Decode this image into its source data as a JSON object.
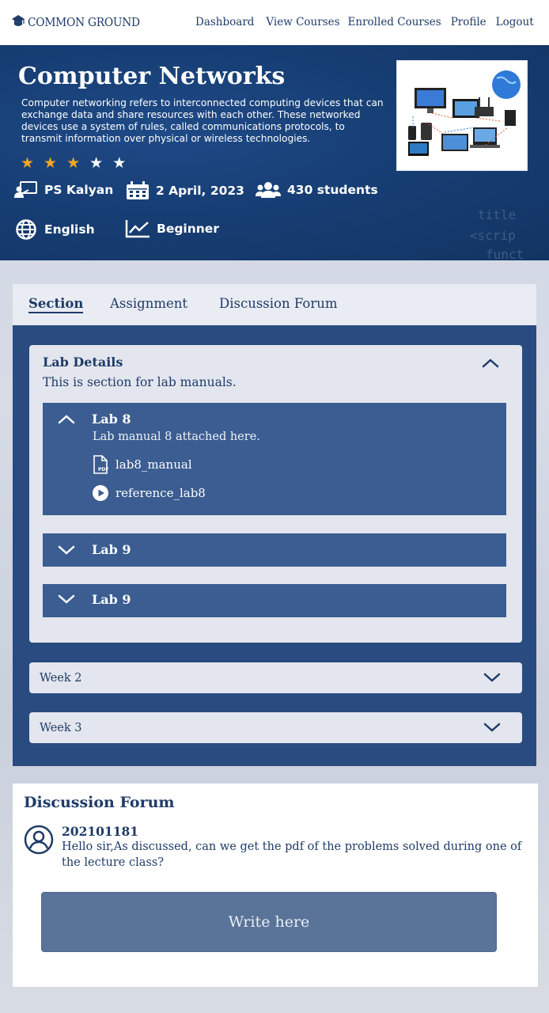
{
  "nav": {
    "brand": "COMMON GROUND",
    "links": [
      "Dashboard",
      "View Courses",
      "Enrolled Courses",
      "Profile",
      "Logout"
    ]
  },
  "course": {
    "title": "Computer Networks",
    "description": "Computer networking refers to interconnected computing devices that can exchange data and share resources with each other. These networked devices use a system of rules, called communications protocols, to transmit information over physical or wireless technologies.",
    "rating": 3,
    "rating_max": 5,
    "instructor": "PS Kalyan",
    "date": "2 April, 2023",
    "students": "430 students",
    "language": "English",
    "level": "Beginner"
  },
  "tabs": [
    "Section",
    "Assignment",
    "Discussion Forum"
  ],
  "section": {
    "title": "Lab Details",
    "subtitle": "This is section for lab manuals.",
    "labs": [
      {
        "name": "Lab 8",
        "description": "Lab manual 8 attached here.",
        "files": [
          {
            "name": "lab8_manual",
            "icon": "pdf-icon"
          },
          {
            "name": "reference_lab8",
            "icon": "play-icon"
          }
        ]
      },
      {
        "name": "Lab 9"
      },
      {
        "name": "Lab 9"
      }
    ],
    "weeks": [
      "Week 2",
      "Week 3"
    ]
  },
  "discussion": {
    "title": "Discussion Forum",
    "user": "202101181",
    "message": "Hello sir,As discussed, can we get the pdf of the problems solved during one of the lecture class?",
    "input_placeholder": "Write here"
  },
  "colors": {
    "primary": "#1f3b68",
    "hero": "#173e74",
    "panel": "#2a4b80",
    "lab_row": "#3b5d91",
    "star": "#f5a623"
  }
}
